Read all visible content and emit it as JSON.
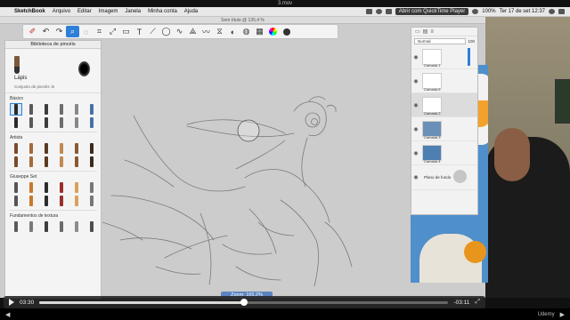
{
  "video": {
    "title": "3.mov"
  },
  "menubar": {
    "app": "SketchBook",
    "items": [
      "Arquivo",
      "Editar",
      "Imagem",
      "Janela",
      "Minha conta",
      "Ajuda"
    ],
    "quicktime": "Abrir com QuickTime Player",
    "battery": "100%",
    "datetime": "Ter 17 de set  12:37"
  },
  "window": {
    "title": "Sem título @ 135,4 %"
  },
  "toolbar": {
    "tools": [
      "brush-tool",
      "undo-icon",
      "redo-icon",
      "zoom-tool",
      "lasso-icon",
      "crop-icon",
      "transform-icon",
      "rect-select-icon",
      "text-tool",
      "ruler-icon",
      "ellipse-icon",
      "curve-icon",
      "perspective-icon",
      "stroke-icon",
      "symmetry-icon",
      "fill-icon",
      "layer-icon",
      "brush-props-icon",
      "color-wheel-icon",
      "color-swatch"
    ]
  },
  "brush_library": {
    "title": "Biblioteca de pincéis",
    "current_brush": "Lápis",
    "brush_set": "Conjunto de pincéis: B",
    "sections": [
      "Básico",
      "Artista",
      "Giuseppe Set",
      "Fundamentos de textura"
    ]
  },
  "layers": {
    "blend_mode": "Normal",
    "opacity": "100",
    "items": [
      {
        "name": "Camada 1",
        "selected": false
      },
      {
        "name": "Camada 6",
        "selected": false
      },
      {
        "name": "Camada 2",
        "selected": true
      },
      {
        "name": "Camada 3",
        "selected": false
      },
      {
        "name": "Camada 4",
        "selected": false
      }
    ],
    "paper": "Plano de fundo"
  },
  "zoom": {
    "label": "Zoom: 165,2%"
  },
  "player": {
    "current": "03:30",
    "remaining": "-03:11",
    "progress": 0.5
  },
  "udemy": "Udemy"
}
